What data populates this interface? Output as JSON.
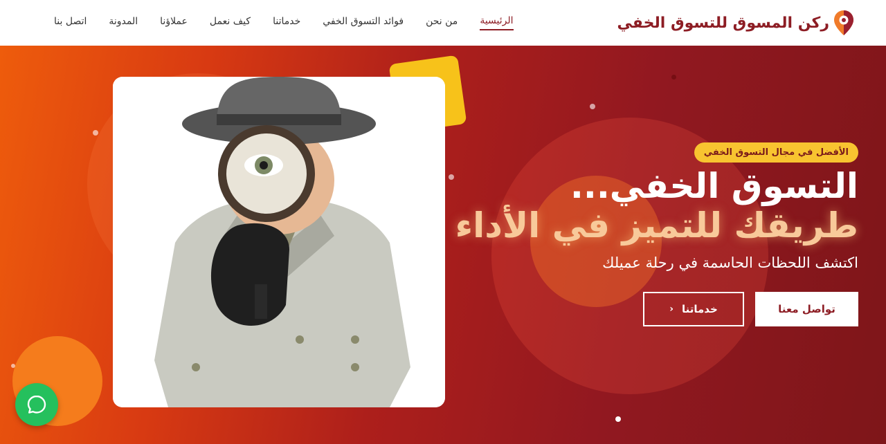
{
  "brand": {
    "name": "ركن المسوق للتسوق الخفي",
    "icon": "location-pin-icon",
    "color": "#8d1d24"
  },
  "nav": {
    "items": [
      {
        "label": "الرئيسية",
        "active": true
      },
      {
        "label": "من نحن",
        "active": false
      },
      {
        "label": "فوائد التسوق الخفي",
        "active": false
      },
      {
        "label": "خدماتنا",
        "active": false
      },
      {
        "label": "كيف نعمل",
        "active": false
      },
      {
        "label": "عملاؤنا",
        "active": false
      },
      {
        "label": "المدونة",
        "active": false
      },
      {
        "label": "اتصل بنا",
        "active": false
      }
    ]
  },
  "hero": {
    "badge": "الأفضل في مجال التسوق الخفي",
    "headline_line1": "التسوق الخفي...",
    "headline_line2": "طريقك للتميز في الأداء",
    "subtitle": "اكتشف اللحظات الحاسمة في رحلة عميلك",
    "primary_button": "تواصل معنا",
    "secondary_button": "خدماتنا",
    "image": "detective-with-magnifying-glass",
    "colors": {
      "gradient_start": "#ee5c0c",
      "gradient_end": "#7e1619",
      "accent_yellow": "#f7c21a",
      "headline_highlight": "#f8c99a"
    }
  },
  "chat": {
    "icon": "whatsapp-chat-icon",
    "color": "#25c05d"
  }
}
